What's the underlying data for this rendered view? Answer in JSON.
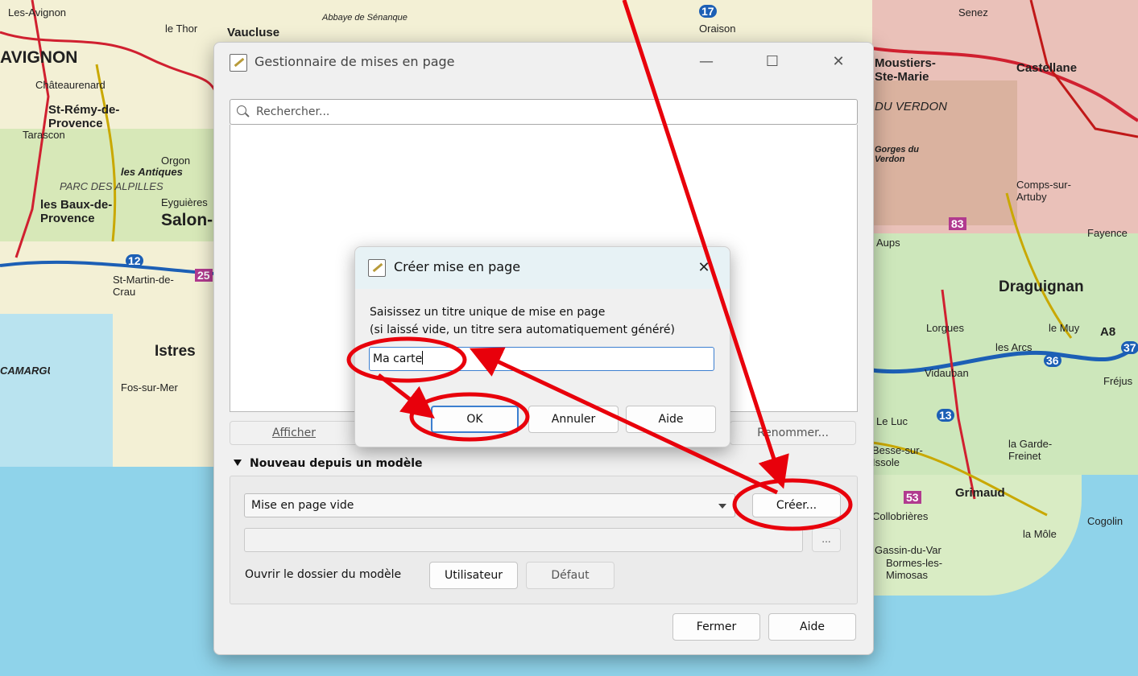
{
  "map": {
    "labels": [
      "Les-Avignon",
      "AVIGNON",
      "le Thor",
      "Vaucluse",
      "Abbaye de Sénanque",
      "Oraison",
      "Senez",
      "Châteaurenard",
      "St-Rémy-de-Provence",
      "Tarascon",
      "Orgon",
      "les Antiques",
      "PARC DES ALPILLES",
      "les Baux-de-Provence",
      "Eyguières",
      "Salon-de-Provence",
      "St-Martin-de-Crau",
      "Istres",
      "Fos-sur-Mer",
      "CAMARGUE",
      "Moustiers-Ste-Marie",
      "Castellane",
      "DU VERDON",
      "Gorges du Verdon",
      "Comps-sur-Artuby",
      "Aups",
      "Fayence",
      "Draguignan",
      "Lorgues",
      "le Muy",
      "les Arcs",
      "Vidauban",
      "Fréjus",
      "A8",
      "la Garde-Freinet",
      "Grimaud",
      "Collobrières",
      "Cogolin",
      "la Môle",
      "Bormes-les-Mimosas",
      "Gassin-du-Var",
      "Le Luc",
      "Besse-sur-Issole"
    ],
    "badges": [
      "83",
      "53",
      "25",
      "13",
      "12",
      "37",
      "36",
      "17"
    ]
  },
  "main_dialog": {
    "title": "Gestionnaire de mises en page",
    "window_controls": {
      "minimize": "—",
      "maximize": "☐",
      "close": "✕"
    },
    "search_placeholder": "Rechercher...",
    "buttons": {
      "show": "Afficher",
      "rename": "Renommer..."
    },
    "section_title": "Nouveau depuis un modèle",
    "template_select": "Mise en page vide",
    "create_button": "Créer...",
    "browse_button": "...",
    "open_folder_label": "Ouvrir le dossier du modèle",
    "user_button": "Utilisateur",
    "default_button": "Défaut",
    "close_button": "Fermer",
    "help_button": "Aide"
  },
  "sub_dialog": {
    "title": "Créer mise en page",
    "close": "✕",
    "prompt_line1": "Saisissez un titre unique de mise en page",
    "prompt_line2": "(si laissé vide, un titre sera automatiquement généré)",
    "title_value": "Ma carte",
    "ok_button": "OK",
    "cancel_button": "Annuler",
    "help_button": "Aide"
  },
  "colors": {
    "annotation_red": "#e8000b",
    "accent_blue": "#3c7fd0",
    "map_sea": "#8fd3ea",
    "map_land": "#f3f0d5"
  }
}
